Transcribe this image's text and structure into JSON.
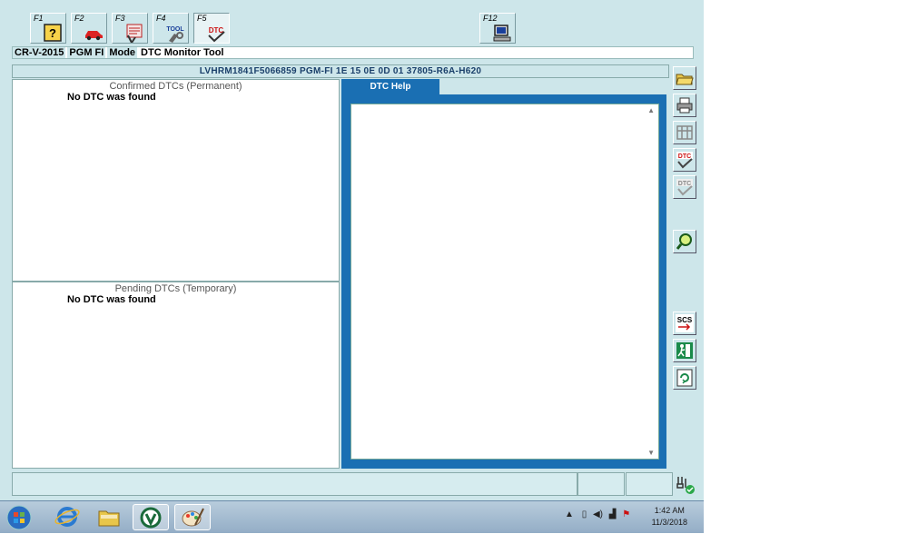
{
  "fkeys": [
    {
      "key": "F1",
      "icon": "help-icon"
    },
    {
      "key": "F2",
      "icon": "car-icon"
    },
    {
      "key": "F3",
      "icon": "data-list-icon"
    },
    {
      "key": "F4",
      "icon": "tool-icon"
    },
    {
      "key": "F5",
      "icon": "dtc-icon",
      "icon_text": "DTC"
    },
    {
      "key": "F12",
      "icon": "computer-icon"
    }
  ],
  "tool_icon_text": "TOOL",
  "mode_bar": {
    "model": "CR-V-2015",
    "system": "PGM FI",
    "mode_label": "Mode",
    "mode_value": "DTC Monitor Tool"
  },
  "vin_bar": "LVHRM1841F5066859  PGM-FI  1E 15 0E 0D 01  37805-R6A-H620",
  "confirmed": {
    "title": "Confirmed DTCs (Permanent)",
    "message": "No DTC was found"
  },
  "pending": {
    "title": "Pending DTCs (Temporary)",
    "message": "No DTC was found"
  },
  "help_tab": "DTC Help",
  "side_buttons": [
    "open-folder-icon",
    "print-icon",
    "freeze-frame-icon",
    "dtc-clear-icon",
    "dtc-check-icon",
    "magnifier-icon",
    "scs-icon",
    "exit-icon",
    "refresh-icon"
  ],
  "scs_text": "SCS",
  "dtc_small_text": "DTC",
  "taskbar": {
    "time": "1:42 AM",
    "date": "11/3/2018"
  },
  "colors": {
    "window_bg": "#cde6ea",
    "help_blue": "#1a6fb3",
    "vin_text": "#1a3f6a"
  }
}
